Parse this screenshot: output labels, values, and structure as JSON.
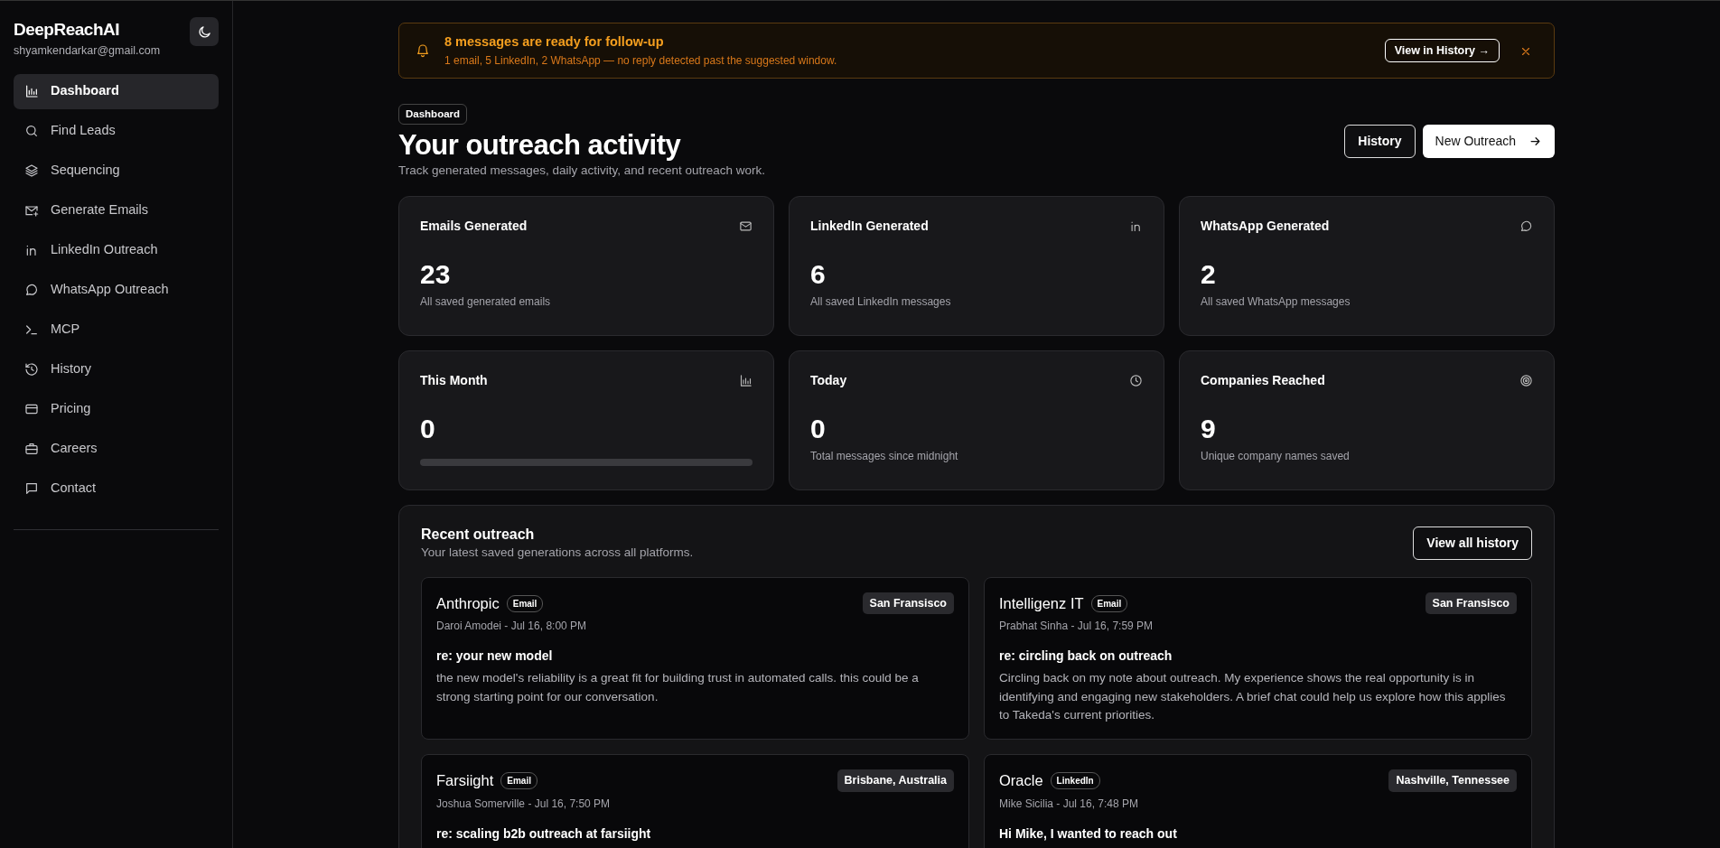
{
  "sidebar": {
    "brand": "DeepReachAI",
    "email": "shyamkendarkar@gmail.com",
    "items": [
      {
        "label": "Dashboard",
        "selected": true
      },
      {
        "label": "Find Leads",
        "selected": false
      },
      {
        "label": "Sequencing",
        "selected": false
      },
      {
        "label": "Generate Emails",
        "selected": false
      },
      {
        "label": "LinkedIn Outreach",
        "selected": false
      },
      {
        "label": "WhatsApp Outreach",
        "selected": false
      },
      {
        "label": "MCP",
        "selected": false
      },
      {
        "label": "History",
        "selected": false
      },
      {
        "label": "Pricing",
        "selected": false
      },
      {
        "label": "Careers",
        "selected": false
      },
      {
        "label": "Contact",
        "selected": false
      }
    ]
  },
  "alert": {
    "title": "8 messages are ready for follow-up",
    "text": "1 email, 5 LinkedIn, 2 WhatsApp — no reply detected past the suggested window.",
    "button": "View in History →"
  },
  "header": {
    "breadcrumb": "Dashboard",
    "title": "Your outreach activity",
    "subtitle": "Track generated messages, daily activity, and recent outreach work.",
    "buttons": [
      "History",
      "New Outreach"
    ]
  },
  "stats": [
    {
      "kind": "text",
      "label": "Emails Generated",
      "value": "23",
      "note": "All saved generated emails"
    },
    {
      "kind": "text",
      "label": "LinkedIn Generated",
      "value": "6",
      "note": "All saved LinkedIn messages"
    },
    {
      "kind": "text",
      "label": "WhatsApp Generated",
      "value": "2",
      "note": "All saved WhatsApp messages"
    },
    {
      "kind": "progress",
      "label": "This Month",
      "value": "0",
      "level": 0
    },
    {
      "kind": "text",
      "label": "Today",
      "value": "0",
      "note": "Total messages since midnight"
    },
    {
      "kind": "text",
      "label": "Companies Reached",
      "value": "9",
      "note": "Unique company names saved"
    }
  ],
  "recent": {
    "title": "Recent outreach",
    "subtitle": "Your latest saved generations across all platforms.",
    "button": "View all history",
    "items": [
      {
        "company": "Anthropic",
        "channel": "Email",
        "location": "San Fransisco",
        "meta": "Daroi Amodei - Jul 16, 8:00 PM",
        "subject": "re: your new model",
        "body": "the new model's reliability is a great fit for building trust in automated calls. this could be a strong starting point for our conversation."
      },
      {
        "company": "Intelligenz IT",
        "channel": "Email",
        "location": "San Fransisco",
        "meta": "Prabhat Sinha - Jul 16, 7:59 PM",
        "subject": "re: circling back on outreach",
        "body": "Circling back on my note about outreach. My experience shows the real opportunity is in identifying and engaging new stakeholders. A brief chat could help us explore how this applies to Takeda's current priorities."
      },
      {
        "company": "Farsiight",
        "channel": "Email",
        "location": "Brisbane, Australia",
        "meta": "Joshua Somerville - Jul 16, 7:50 PM",
        "subject": "re: scaling b2b outreach at farsiight"
      },
      {
        "company": "Oracle",
        "channel": "LinkedIn",
        "location": "Nashville, Tennessee",
        "meta": "Mike Sicilia - Jul 16, 7:48 PM",
        "subject": "Hi Mike, I wanted to reach out"
      }
    ]
  }
}
